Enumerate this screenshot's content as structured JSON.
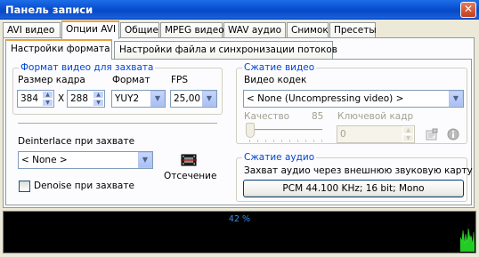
{
  "window": {
    "title": "Панель записи",
    "close_glyph": "✕"
  },
  "tabs": [
    "AVI видео",
    "Опции AVI",
    "Общие",
    "MPEG видео",
    "WAV аудио",
    "Снимок",
    "Пресеты"
  ],
  "subtabs": [
    "Настройки формата",
    "Настройки файла и синхронизации потоков"
  ],
  "video_format": {
    "group_title": "Формат видео для захвата",
    "frame_size_label": "Размер кадра",
    "width": "384",
    "separator": "X",
    "height": "288",
    "format_label": "Формат",
    "format_value": "YUY2",
    "fps_label": "FPS",
    "fps_value": "25,00"
  },
  "deinterlace": {
    "label": "Deinterlace при захвате",
    "value": "< None >",
    "denoise_label": "Denoise при захвате",
    "denoise_checked": false,
    "crop_label": "Отсечение",
    "crop_icon": "film-crop-icon"
  },
  "video_compression": {
    "group_title": "Сжатие видео",
    "codec_label": "Видео кодек",
    "codec_value": "< None (Uncompressing video) >",
    "quality_label": "Качество",
    "quality_value": "85",
    "keyframe_label": "Ключевой кадр",
    "keyframe_value": "0",
    "properties_icon": "properties-icon",
    "info_icon": "info-icon"
  },
  "audio_compression": {
    "group_title": "Сжатие аудио",
    "description": "Захват аудио через внешнюю звуковую карту",
    "format_button": "PCM 44.100 KHz; 16 bit; Mono"
  },
  "monitor": {
    "percent_text": "42 %",
    "level_color": "#22cc22"
  }
}
